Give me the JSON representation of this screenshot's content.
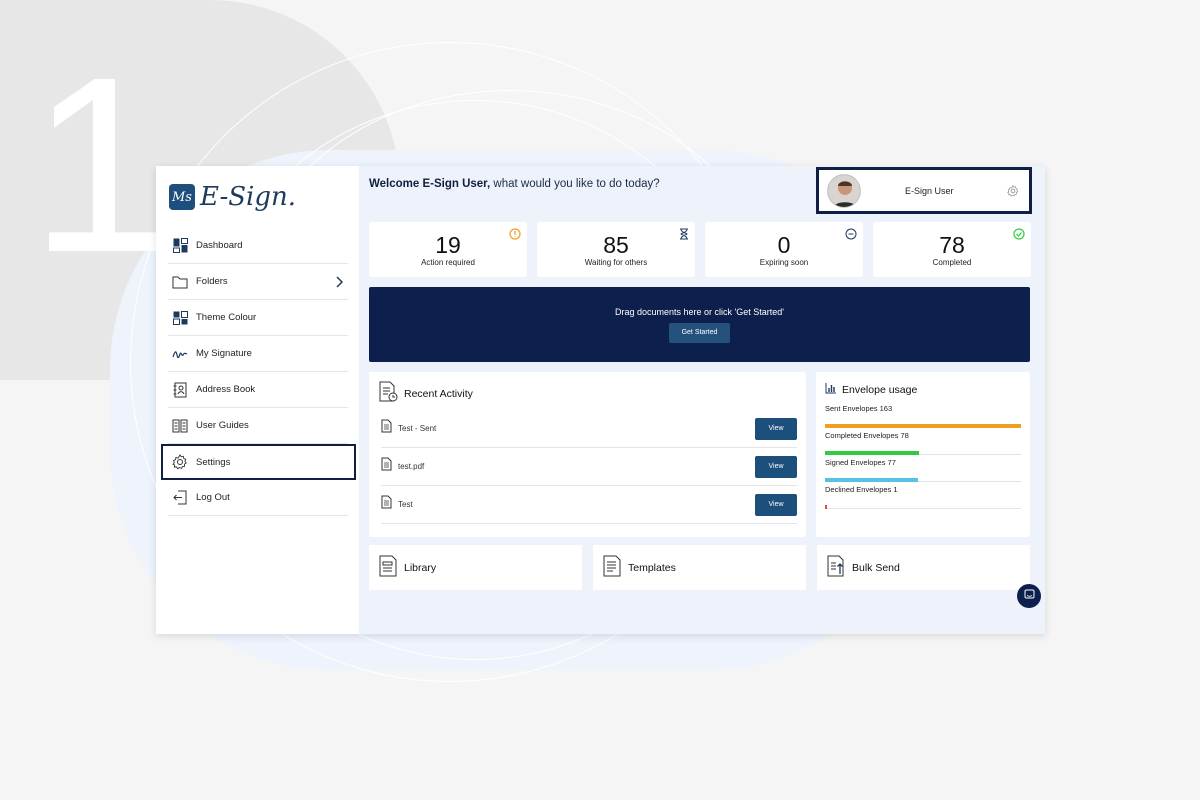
{
  "step_number": "1",
  "brand": {
    "logo_mark": "Ms",
    "name": "E-Sign."
  },
  "sidebar": {
    "items": [
      {
        "label": "Dashboard",
        "icon": "dashboard-icon"
      },
      {
        "label": "Folders",
        "icon": "folder-icon"
      },
      {
        "label": "Theme Colour",
        "icon": "theme-icon"
      },
      {
        "label": "My Signature",
        "icon": "signature-icon"
      },
      {
        "label": "Address Book",
        "icon": "address-book-icon"
      },
      {
        "label": "User Guides",
        "icon": "user-guides-icon"
      },
      {
        "label": "Settings",
        "icon": "gear-icon",
        "active": true
      },
      {
        "label": "Log Out",
        "icon": "logout-icon"
      }
    ]
  },
  "header": {
    "welcome_bold": "Welcome E-Sign User,",
    "welcome_rest": " what would you like to do today?",
    "user_name": "E-Sign User"
  },
  "stats": [
    {
      "value": "19",
      "label": "Action required",
      "icon": "alert-icon",
      "color": "#f0a020"
    },
    {
      "value": "85",
      "label": "Waiting for others",
      "icon": "hourglass-icon",
      "color": "#1d3a5c"
    },
    {
      "value": "0",
      "label": "Expiring soon",
      "icon": "clock-icon",
      "color": "#1d3a5c"
    },
    {
      "value": "78",
      "label": "Completed",
      "icon": "check-circle-icon",
      "color": "#2ecc40"
    }
  ],
  "dropzone": {
    "text": "Drag documents here or click 'Get Started'",
    "button": "Get Started"
  },
  "recent": {
    "title": "Recent Activity",
    "items": [
      {
        "name": "Test - Sent",
        "action": "View"
      },
      {
        "name": "test.pdf",
        "action": "View"
      },
      {
        "name": "Test",
        "action": "View"
      }
    ]
  },
  "usage": {
    "title": "Envelope usage",
    "rows": [
      {
        "label": "Sent Envelopes 163",
        "value": 163,
        "color": "#f0a020"
      },
      {
        "label": "Completed Envelopes 78",
        "value": 78,
        "color": "#2ecc40"
      },
      {
        "label": "Signed Envelopes 77",
        "value": 77,
        "color": "#5bc0e8"
      },
      {
        "label": "Declined Envelopes 1",
        "value": 1,
        "color": "#e74c3c"
      }
    ],
    "max": 163
  },
  "tiles": [
    {
      "label": "Library",
      "icon": "library-icon"
    },
    {
      "label": "Templates",
      "icon": "templates-icon"
    },
    {
      "label": "Bulk Send",
      "icon": "bulk-send-icon"
    }
  ]
}
